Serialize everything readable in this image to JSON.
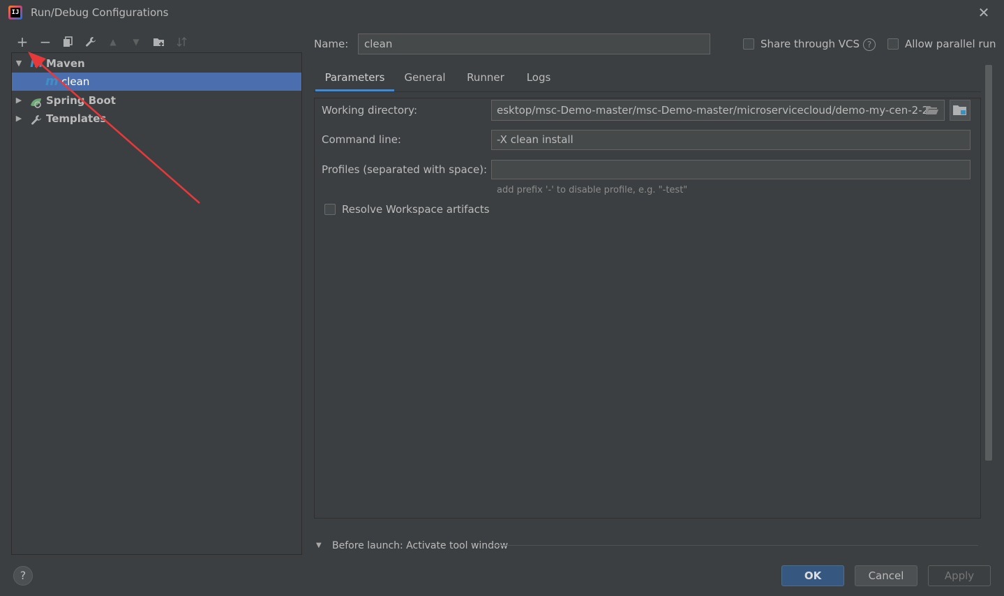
{
  "window": {
    "title": "Run/Debug Configurations",
    "close_glyph": "✕",
    "app_icon_text": "IJ"
  },
  "toolbar": {
    "add": "+",
    "remove": "−",
    "copy": "⧉",
    "edit": "🔧",
    "move_up": "▲",
    "move_down": "▼",
    "new_folder": "📁",
    "sort": "⇅"
  },
  "tree": {
    "maven": {
      "label": "Maven",
      "icon": "m"
    },
    "clean": {
      "label": "clean",
      "icon": "m"
    },
    "spring_boot": {
      "label": "Spring Boot"
    },
    "templates": {
      "label": "Templates"
    }
  },
  "config": {
    "name_label": "Name:",
    "name_value": "clean",
    "share_label": "Share through VCS",
    "parallel_label": "Allow parallel run",
    "help_glyph": "?"
  },
  "tabs": [
    "Parameters",
    "General",
    "Runner",
    "Logs"
  ],
  "parameters": {
    "working_dir_label": "Working directory:",
    "working_dir_value": "esktop/msc-Demo-master/msc-Demo-master/microservicecloud/demo-my-cen-2-2",
    "command_line_label": "Command line:",
    "command_line_value": "-X clean install",
    "profiles_label": "Profiles (separated with space):",
    "profiles_value": "",
    "profiles_hint": "add prefix '-' to disable profile, e.g. \"-test\"",
    "resolve_label": "Resolve Workspace artifacts"
  },
  "before_launch": {
    "label": "Before launch: Activate tool window"
  },
  "footer": {
    "ok": "OK",
    "cancel": "Cancel",
    "apply": "Apply",
    "help": "?"
  },
  "colors": {
    "background": "#3c3f41",
    "selection": "#4b6eaf",
    "accent": "#4a88c7",
    "annotation_arrow": "#e8393a"
  }
}
